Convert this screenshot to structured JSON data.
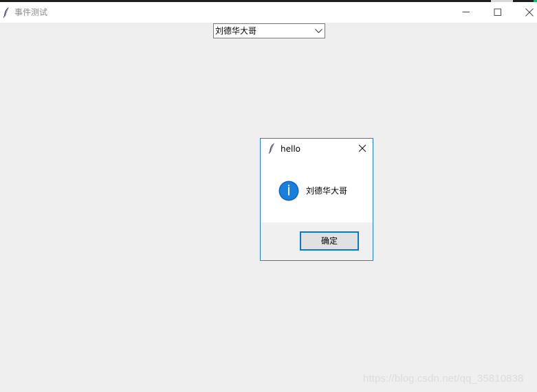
{
  "window": {
    "title": "事件测试",
    "icon": "tk-feather-icon",
    "controls": [
      "minimize-icon",
      "maximize-icon",
      "close-icon"
    ]
  },
  "combobox": {
    "selected": "刘德华大哥",
    "icon": "chevron-down-icon"
  },
  "dialog": {
    "title": "hello",
    "icon": "info-icon",
    "message": "刘德华大哥",
    "ok_label": "确定",
    "accent": "#0078d7"
  },
  "watermark": "https://blog.csdn.net/qq_35810838"
}
